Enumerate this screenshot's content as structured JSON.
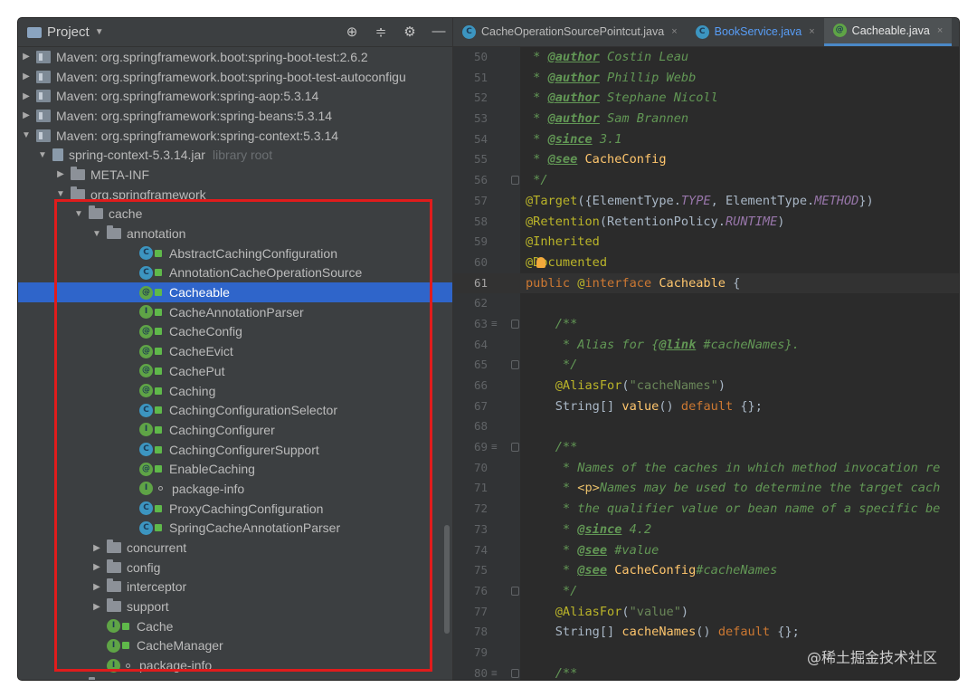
{
  "project_panel": {
    "title": "Project",
    "tree": [
      {
        "indent": 0,
        "arrow": "right",
        "icon": "library",
        "label": "Maven: org.springframework.boot:spring-boot-test:2.6.2"
      },
      {
        "indent": 0,
        "arrow": "right",
        "icon": "library",
        "label": "Maven: org.springframework.boot:spring-boot-test-autoconfigu"
      },
      {
        "indent": 0,
        "arrow": "right",
        "icon": "library",
        "label": "Maven: org.springframework:spring-aop:5.3.14"
      },
      {
        "indent": 0,
        "arrow": "right",
        "icon": "library",
        "label": "Maven: org.springframework:spring-beans:5.3.14"
      },
      {
        "indent": 0,
        "arrow": "down",
        "icon": "library",
        "label": "Maven: org.springframework:spring-context:5.3.14"
      },
      {
        "indent": 1,
        "arrow": "down",
        "icon": "jar",
        "label": "spring-context-5.3.14.jar",
        "muted": "library root"
      },
      {
        "indent": 2,
        "arrow": "right",
        "icon": "package",
        "label": "META-INF"
      },
      {
        "indent": 2,
        "arrow": "down",
        "icon": "package",
        "label": "org.springframework"
      },
      {
        "indent": 3,
        "arrow": "down",
        "icon": "package",
        "label": "cache"
      },
      {
        "indent": 4,
        "arrow": "down",
        "icon": "package",
        "label": "annotation"
      },
      {
        "indent": 5,
        "arrow": "none",
        "icon": "class-c",
        "label": "AbstractCachingConfiguration"
      },
      {
        "indent": 5,
        "arrow": "none",
        "icon": "class-c",
        "label": "AnnotationCacheOperationSource"
      },
      {
        "indent": 5,
        "arrow": "none",
        "icon": "annotation",
        "label": "Cacheable",
        "selected": true
      },
      {
        "indent": 5,
        "arrow": "none",
        "icon": "interface",
        "label": "CacheAnnotationParser"
      },
      {
        "indent": 5,
        "arrow": "none",
        "icon": "annotation",
        "label": "CacheConfig"
      },
      {
        "indent": 5,
        "arrow": "none",
        "icon": "annotation",
        "label": "CacheEvict"
      },
      {
        "indent": 5,
        "arrow": "none",
        "icon": "annotation",
        "label": "CachePut"
      },
      {
        "indent": 5,
        "arrow": "none",
        "icon": "annotation",
        "label": "Caching"
      },
      {
        "indent": 5,
        "arrow": "none",
        "icon": "class-c",
        "label": "CachingConfigurationSelector"
      },
      {
        "indent": 5,
        "arrow": "none",
        "icon": "interface",
        "label": "CachingConfigurer"
      },
      {
        "indent": 5,
        "arrow": "none",
        "icon": "class-c",
        "label": "CachingConfigurerSupport"
      },
      {
        "indent": 5,
        "arrow": "none",
        "icon": "annotation",
        "label": "EnableCaching"
      },
      {
        "indent": 5,
        "arrow": "none",
        "icon": "interface-dot",
        "label": "package-info"
      },
      {
        "indent": 5,
        "arrow": "none",
        "icon": "class-c",
        "label": "ProxyCachingConfiguration"
      },
      {
        "indent": 5,
        "arrow": "none",
        "icon": "class-c",
        "label": "SpringCacheAnnotationParser"
      },
      {
        "indent": 4,
        "arrow": "right",
        "icon": "package",
        "label": "concurrent"
      },
      {
        "indent": 4,
        "arrow": "right",
        "icon": "package",
        "label": "config"
      },
      {
        "indent": 4,
        "arrow": "right",
        "icon": "package",
        "label": "interceptor"
      },
      {
        "indent": 4,
        "arrow": "right",
        "icon": "package",
        "label": "support"
      },
      {
        "indent": 4,
        "arrow": "none",
        "icon": "interface",
        "label": "Cache"
      },
      {
        "indent": 4,
        "arrow": "none",
        "icon": "interface",
        "label": "CacheManager"
      },
      {
        "indent": 4,
        "arrow": "none",
        "icon": "interface-dot",
        "label": "package-info"
      },
      {
        "indent": 3,
        "arrow": "right",
        "icon": "package",
        "label": "context"
      }
    ]
  },
  "editor": {
    "tabs": [
      {
        "label": "CacheOperationSourcePointcut.java",
        "style": "normal"
      },
      {
        "label": "BookService.java",
        "style": "link"
      },
      {
        "label": "Cacheable.java",
        "style": "active"
      },
      {
        "label": "",
        "style": "normal"
      }
    ],
    "current_line": 61,
    "lines": [
      {
        "n": 50,
        "parts": [
          [
            "comment",
            " * "
          ],
          [
            "tag",
            "@author"
          ],
          [
            "comment",
            " Costin Leau"
          ]
        ]
      },
      {
        "n": 51,
        "parts": [
          [
            "comment",
            " * "
          ],
          [
            "tag",
            "@author"
          ],
          [
            "comment",
            " Phillip Webb"
          ]
        ]
      },
      {
        "n": 52,
        "parts": [
          [
            "comment",
            " * "
          ],
          [
            "tag",
            "@author"
          ],
          [
            "comment",
            " Stephane Nicoll"
          ]
        ]
      },
      {
        "n": 53,
        "parts": [
          [
            "comment",
            " * "
          ],
          [
            "tag",
            "@author"
          ],
          [
            "comment",
            " Sam Brannen"
          ]
        ]
      },
      {
        "n": 54,
        "parts": [
          [
            "comment",
            " * "
          ],
          [
            "tag",
            "@since"
          ],
          [
            "comment",
            " 3.1"
          ]
        ]
      },
      {
        "n": 55,
        "parts": [
          [
            "comment",
            " * "
          ],
          [
            "tag",
            "@see"
          ],
          [
            "comment",
            " "
          ],
          [
            "cname",
            "CacheConfig"
          ]
        ]
      },
      {
        "n": 56,
        "parts": [
          [
            "comment",
            " */"
          ]
        ],
        "fold": true
      },
      {
        "n": 57,
        "parts": [
          [
            "ann",
            "@Target"
          ],
          [
            "plain",
            "({ElementType."
          ],
          [
            "const",
            "TYPE"
          ],
          [
            "plain",
            ", ElementType."
          ],
          [
            "const",
            "METHOD"
          ],
          [
            "plain",
            "})"
          ]
        ]
      },
      {
        "n": 58,
        "parts": [
          [
            "ann",
            "@Retention"
          ],
          [
            "plain",
            "(RetentionPolicy."
          ],
          [
            "const",
            "RUNTIME"
          ],
          [
            "plain",
            ")"
          ]
        ]
      },
      {
        "n": 59,
        "parts": [
          [
            "ann",
            "@Inherited"
          ]
        ]
      },
      {
        "n": 60,
        "parts": [
          [
            "ann",
            "@Documented"
          ]
        ],
        "bulb": true
      },
      {
        "n": 61,
        "parts": [
          [
            "kw",
            "public "
          ],
          [
            "ann",
            "@"
          ],
          [
            "kw",
            "interface "
          ],
          [
            "cname",
            "Cacheable"
          ],
          [
            "plain",
            " {"
          ]
        ]
      },
      {
        "n": 62,
        "parts": []
      },
      {
        "n": 63,
        "parts": [
          [
            "comment",
            "    /**"
          ]
        ],
        "fold": true,
        "mark": true
      },
      {
        "n": 64,
        "parts": [
          [
            "comment",
            "     * Alias for {"
          ],
          [
            "tag",
            "@link"
          ],
          [
            "comment",
            " #cacheNames}."
          ]
        ]
      },
      {
        "n": 65,
        "parts": [
          [
            "comment",
            "     */"
          ]
        ],
        "fold": true
      },
      {
        "n": 66,
        "parts": [
          [
            "ann",
            "    @AliasFor"
          ],
          [
            "plain",
            "("
          ],
          [
            "str",
            "\"cacheNames\""
          ],
          [
            "plain",
            ")"
          ]
        ]
      },
      {
        "n": 67,
        "parts": [
          [
            "plain",
            "    String[] "
          ],
          [
            "fn",
            "value"
          ],
          [
            "plain",
            "() "
          ],
          [
            "kw",
            "default"
          ],
          [
            "plain",
            " {};"
          ]
        ]
      },
      {
        "n": 68,
        "parts": []
      },
      {
        "n": 69,
        "parts": [
          [
            "comment",
            "    /**"
          ]
        ],
        "fold": true,
        "mark": true
      },
      {
        "n": 70,
        "parts": [
          [
            "comment",
            "     * Names of the caches in which method invocation re"
          ]
        ]
      },
      {
        "n": 71,
        "parts": [
          [
            "comment",
            "     * "
          ],
          [
            "htmltag",
            "<p>"
          ],
          [
            "comment",
            "Names may be used to determine the target cach"
          ]
        ]
      },
      {
        "n": 72,
        "parts": [
          [
            "comment",
            "     * the qualifier value or bean name of a specific be"
          ]
        ]
      },
      {
        "n": 73,
        "parts": [
          [
            "comment",
            "     * "
          ],
          [
            "tag",
            "@since"
          ],
          [
            "comment",
            " 4.2"
          ]
        ]
      },
      {
        "n": 74,
        "parts": [
          [
            "comment",
            "     * "
          ],
          [
            "tag",
            "@see"
          ],
          [
            "comment",
            " #value"
          ]
        ]
      },
      {
        "n": 75,
        "parts": [
          [
            "comment",
            "     * "
          ],
          [
            "tag",
            "@see"
          ],
          [
            "comment",
            " "
          ],
          [
            "cname",
            "CacheConfig"
          ],
          [
            "comment",
            "#cacheNames"
          ]
        ]
      },
      {
        "n": 76,
        "parts": [
          [
            "comment",
            "     */"
          ]
        ],
        "fold": true
      },
      {
        "n": 77,
        "parts": [
          [
            "ann",
            "    @AliasFor"
          ],
          [
            "plain",
            "("
          ],
          [
            "str",
            "\"value\""
          ],
          [
            "plain",
            ")"
          ]
        ]
      },
      {
        "n": 78,
        "parts": [
          [
            "plain",
            "    String[] "
          ],
          [
            "fn",
            "cacheNames"
          ],
          [
            "plain",
            "() "
          ],
          [
            "kw",
            "default"
          ],
          [
            "plain",
            " {};"
          ]
        ]
      },
      {
        "n": 79,
        "parts": []
      },
      {
        "n": 80,
        "parts": [
          [
            "comment",
            "    /**"
          ]
        ],
        "fold": true,
        "mark": true
      }
    ]
  },
  "watermark": "@稀土掘金技术社区",
  "highlight_color": "#e01c1c"
}
